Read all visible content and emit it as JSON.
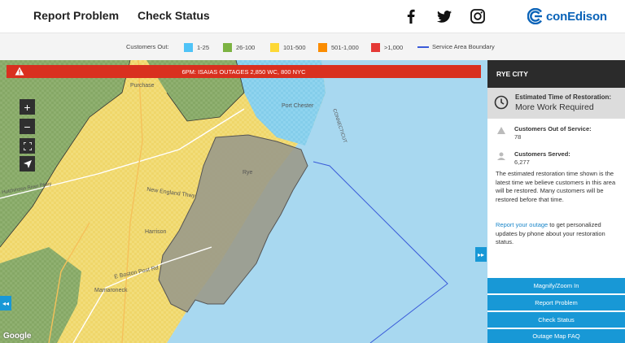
{
  "header": {
    "nav": [
      "Report Problem",
      "Check Status"
    ],
    "social": [
      "facebook-icon",
      "twitter-icon",
      "instagram-icon"
    ],
    "logo_text": "conEdison"
  },
  "legend": {
    "title": "Customers Out:",
    "items": [
      {
        "label": "1-25",
        "color": "#4fc3f7"
      },
      {
        "label": "26-100",
        "color": "#7cb342"
      },
      {
        "label": "101-500",
        "color": "#fdd835"
      },
      {
        "label": "501-1,000",
        "color": "#fb8c00"
      },
      {
        "label": ">1,000",
        "color": "#e53935"
      }
    ],
    "boundary_label": "Service Area Boundary",
    "boundary_color": "#3a5bd9"
  },
  "alert": {
    "text": "6PM: ISAIAS OUTAGES 2,850 WC, 800 NYC",
    "color": "#d9301f"
  },
  "map": {
    "zoom_controls": [
      "+",
      "−"
    ],
    "labels": {
      "port_chester": "Port Chester",
      "harrison": "Harrison",
      "rye": "Rye",
      "new_england_twy": "New England Thwy",
      "boston_post_rd": "E Boston Post Rd",
      "mamaroneck": "Mamaroneck",
      "connecticut": "CONNECTICUT",
      "hutchinson": "Hutchinson River Pkwy",
      "purchase": "Purchase"
    },
    "google": "Google"
  },
  "panel": {
    "title": "RYE CITY",
    "est_label": "Estimated Time of Restoration:",
    "est_value": "More Work Required",
    "customers_out_label": "Customers Out of Service:",
    "customers_out_value": "78",
    "customers_served_label": "Customers Served:",
    "customers_served_value": "6,277",
    "description": "The estimated restoration time shown is the latest time we believe customers in this area will be restored. Many customers will be restored before that time.",
    "report_link": "Report your outage",
    "report_rest": " to get personalized updates by phone about your restoration status.",
    "buttons": [
      "Magnify/Zoom In",
      "Report Problem",
      "Check Status",
      "Outage Map FAQ"
    ]
  },
  "colors": {
    "accent": "#1898d6",
    "water": "#a8d8f0",
    "selected_area": "#9a9a8a"
  }
}
